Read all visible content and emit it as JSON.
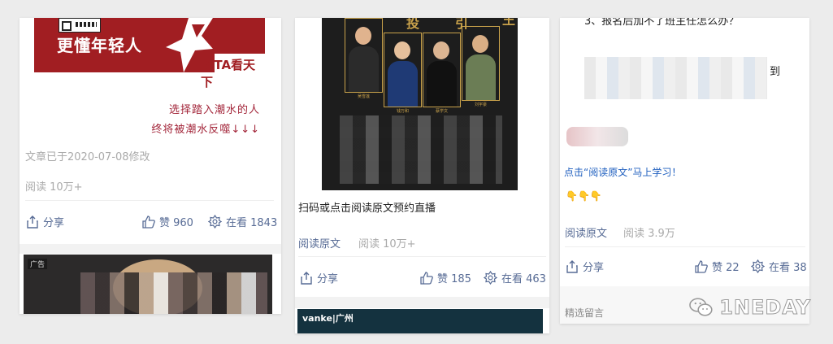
{
  "card1": {
    "banner": {
      "slogan": "更懂年轻人",
      "brand": "ISTA看天下"
    },
    "quote_lines": [
      "选择踏入潮水的人",
      "终将被潮水反噬↓↓↓"
    ],
    "modified": "文章已于2020-07-08修改",
    "reads": "阅读 10万+",
    "share_label": "分享",
    "like_label": "赞 960",
    "watch_label": "在看 1843",
    "ad_tag": "广告"
  },
  "card2": {
    "poster_text": [
      "投",
      "引",
      "王"
    ],
    "poster_names": [
      "吴雪莲",
      "钱万和",
      "蔡学文",
      "刘宇豪"
    ],
    "caption": "扫码或点击阅读原文预约直播",
    "read_original": "阅读原文",
    "reads": "阅读 10万+",
    "share_label": "分享",
    "like_label": "赞 185",
    "watch_label": "在看 463",
    "ad_logo": "vanke|广州"
  },
  "card3": {
    "question": "3、报名后加不了班主任怎么办？",
    "dao": "到",
    "link_text": "点击“阅读原文”马上学习！",
    "hands": "👇👇👇",
    "read_original": "阅读原文",
    "reads": "阅读 3.9万",
    "share_label": "分享",
    "like_label": "赞 22",
    "watch_label": "在看 38",
    "comments_label": "精选留言"
  },
  "watermark": {
    "text": "1NEDAY",
    "icon": "wechat-icon"
  },
  "colors": {
    "link": "#576b95",
    "brand_red": "#a11e22",
    "quote": "#a3263a"
  }
}
